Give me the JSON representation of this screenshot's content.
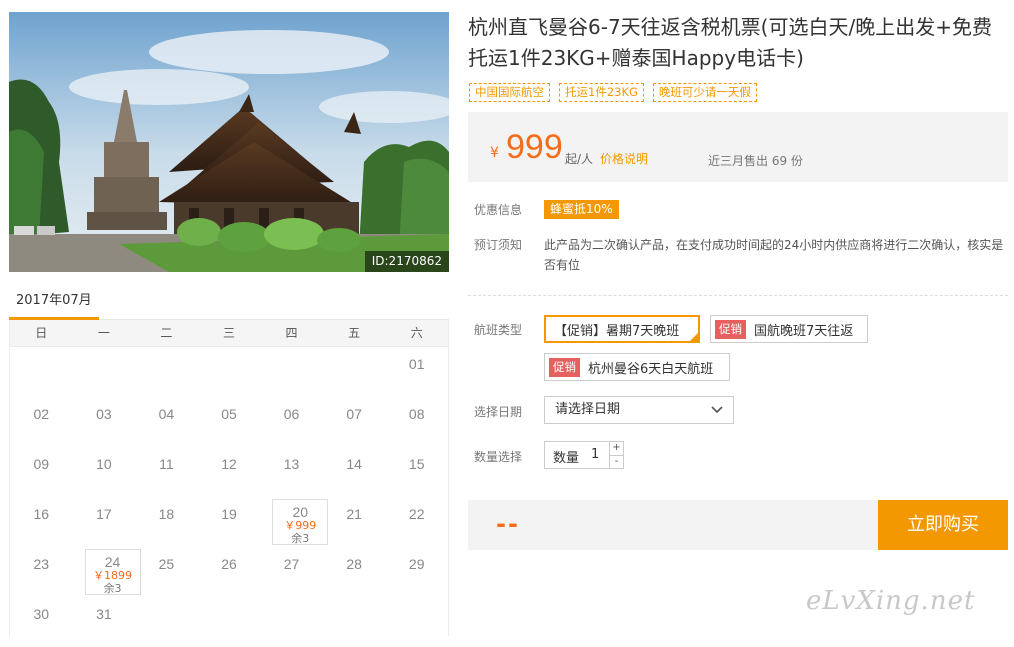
{
  "hero": {
    "id_label": "ID:2170862"
  },
  "calendar": {
    "month": "2017年07月",
    "weekdays": [
      "日",
      "一",
      "二",
      "三",
      "四",
      "五",
      "六"
    ],
    "days": [
      "01",
      "02",
      "03",
      "04",
      "05",
      "06",
      "07",
      "08",
      "09",
      "10",
      "11",
      "12",
      "13",
      "14",
      "15",
      "16",
      "17",
      "18",
      "19",
      "20",
      "21",
      "22",
      "23",
      "24",
      "25",
      "26",
      "27",
      "28",
      "29",
      "30",
      "31"
    ],
    "available": {
      "20": {
        "price": "￥999",
        "stock": "余3"
      },
      "24": {
        "price": "￥1899",
        "stock": "余3"
      }
    }
  },
  "product": {
    "title": "杭州直飞曼谷6-7天往返含税机票(可选白天/晚上出发+免费托运1件23KG+赠泰国Happy电话卡)",
    "tags": [
      "中国国际航空",
      "托运1件23KG",
      "晚班可少请一天假"
    ],
    "price": {
      "currency": "¥",
      "amount": "999",
      "unit": "起/人",
      "link": "价格说明",
      "sold": "近三月售出 69 份"
    },
    "discount": {
      "label": "优惠信息",
      "badge": "蜂蜜抵10%"
    },
    "notice": {
      "label": "预订须知",
      "text": "此产品为二次确认产品，在支付成功时间起的24小时内供应商将进行二次确认，核实是否有位"
    },
    "flight": {
      "label": "航班类型",
      "options": [
        {
          "text": "【促销】暑期7天晚班"
        },
        {
          "promo": "促销",
          "text": "国航晚班7天往返"
        },
        {
          "promo": "促销",
          "text": "杭州曼谷6天白天航班"
        }
      ]
    },
    "date": {
      "label": "选择日期",
      "placeholder": "请选择日期"
    },
    "quantity": {
      "label": "数量选择",
      "field_label": "数量",
      "value": "1",
      "plus": "+",
      "minus": "-"
    },
    "total": "--",
    "buy_button": "立即购买"
  },
  "watermark": "eLvXing.net",
  "colors": {
    "accent": "#f39800",
    "price": "#f56c1b",
    "promo": "#e66060"
  }
}
